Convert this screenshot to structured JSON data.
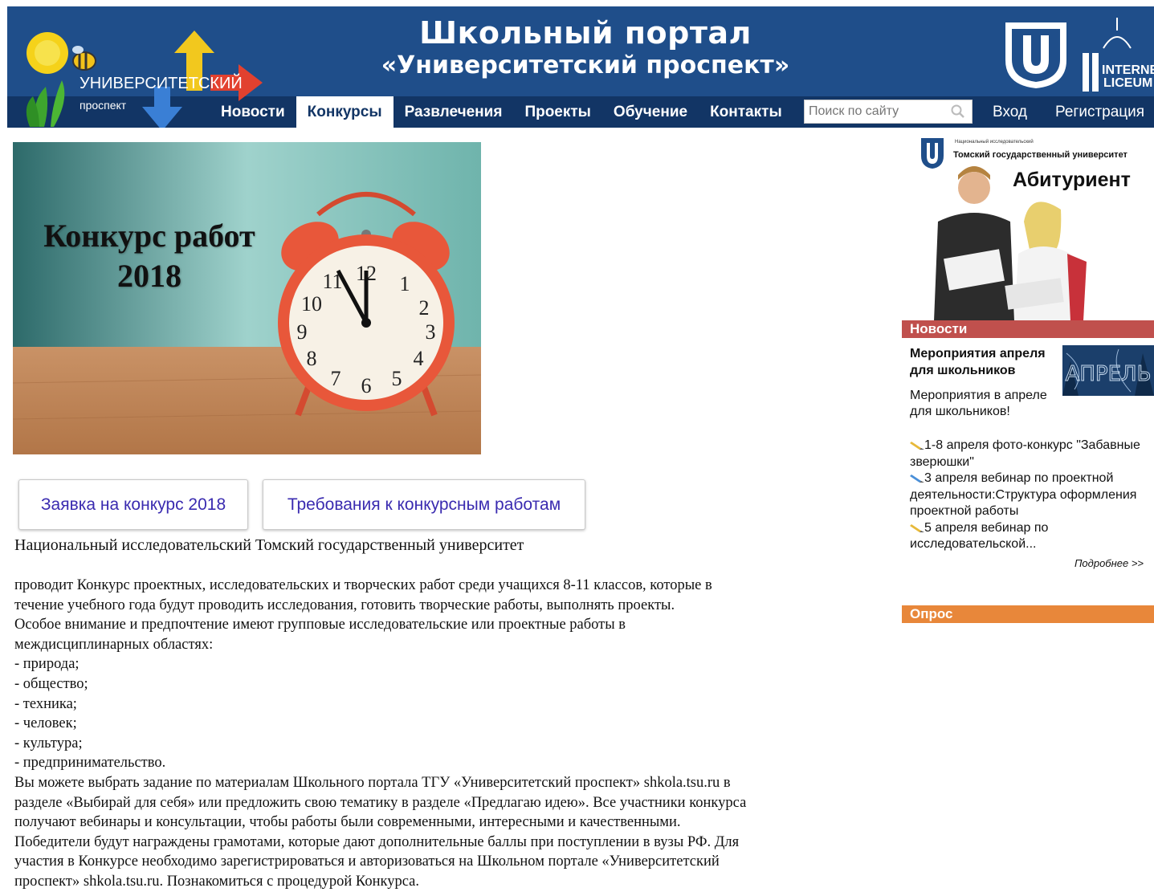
{
  "header": {
    "site_title_line1": "Школьный портал",
    "site_title_line2": "«Университетский проспект»",
    "logo_text_main": "УНИВЕРСИТЕТСКИЙ",
    "logo_text_sub": "проспект",
    "partner_logo_text1": "INTERNET",
    "partner_logo_text2": "LICEUM",
    "nav": [
      {
        "label": "Новости",
        "active": false
      },
      {
        "label": "Конкурсы",
        "active": true
      },
      {
        "label": "Развлечения",
        "active": false
      },
      {
        "label": "Проекты",
        "active": false
      },
      {
        "label": "Обучение",
        "active": false
      },
      {
        "label": "Контакты",
        "active": false
      }
    ],
    "search_placeholder": "Поиск по сайту",
    "login_label": "Вход",
    "register_label": "Регистрация"
  },
  "banner": {
    "line1": "Конкурс работ",
    "line2": "2018"
  },
  "buttons": {
    "application": "Заявка на конкурс 2018",
    "requirements": "Требования к конкурсным работам"
  },
  "content": {
    "organizer": "Национальный исследовательский Томский государственный университет",
    "paragraphs": [
      "проводит Конкурс проектных, исследовательских и творческих работ среди учащихся 8-11 классов, которые в",
      "течение учебного года будут проводить исследования, готовить творческие работы, выполнять проекты.",
      "Особое внимание и предпочтение имеют групповые исследовательские или проектные работы в",
      "междисциплинарных областях:",
      "- природа;",
      "- общество;",
      "- техника;",
      "- человек;",
      "- культура;",
      "- предпринимательство.",
      "Вы можете выбрать задание по материалам Школьного портала ТГУ «Университетский проспект» shkola.tsu.ru в",
      "разделе «Выбирай для себя» или предложить свою тематику в разделе «Предлагаю идею». Все участники конкурса",
      "получают вебинары и консультации, чтобы работы были современными, интересными и качественными.",
      "Победители будут награждены грамотами, которые дают дополнительные баллы при поступлении в вузы РФ. Для",
      "участия в Конкурсе необходимо зарегистрироваться и авторизоваться на Школьном портале «Университетский",
      "проспект» shkola.tsu.ru. Познакомиться с процедурой Конкурса."
    ]
  },
  "sidebar": {
    "ad": {
      "org_small": "Национальный исследовательский",
      "org": "Томский государственный университет",
      "headline": "Абитуриент"
    },
    "news_header": "Новости",
    "news_title": "Мероприятия апреля для школьников",
    "news_image_text": "АПРЕЛЬ",
    "news_desc": "Мероприятия в апреле для школьников!",
    "news_items": [
      "1-8 апреля фото-конкурс \"Забавные зверюшки\"",
      "3 апреля вебинар по проектной деятельности:Структура оформления проектной работы",
      "5 апреля вебинар по исследовательской..."
    ],
    "more_link": "Подробнее >>",
    "poll_header": "Опрос"
  },
  "colors": {
    "header_bg": "#1f4e8a",
    "nav_bg": "#123565",
    "news_header_bg": "#c0504d",
    "poll_header_bg": "#e8873a",
    "button_text": "#3a2bb0"
  }
}
